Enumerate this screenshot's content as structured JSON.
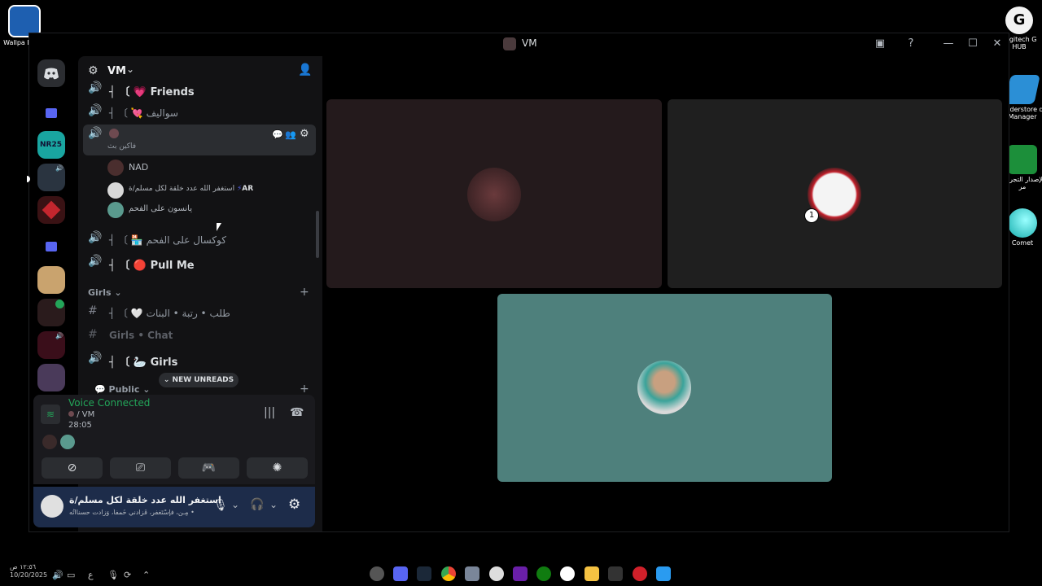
{
  "desktop": {
    "left_icons": [
      {
        "label": "Wallpaper Engine",
        "short": "Wallpa Engin"
      }
    ],
    "right_icons": [
      {
        "label": "Logitech G HUB",
        "short": "Logitech G HUB"
      },
      {
        "label": "Thunderstore Mod Manager",
        "short": "underst­ore d Manager"
      },
      {
        "label": "الإصدار التجريبي",
        "short": "الإصدار التجريبي مر"
      },
      {
        "label": "Comet",
        "short": "Comet"
      }
    ]
  },
  "window": {
    "title": "VM",
    "controls": {
      "inbox": "▣",
      "help": "?",
      "minimize": "—",
      "maximize": "☐",
      "close": "✕"
    }
  },
  "guild": {
    "name": "VM",
    "chevron": "⌄",
    "invite_icon": "add-member-icon"
  },
  "channels": {
    "items": [
      {
        "icon": "🔊",
        "prefix": "┤ 〔",
        "emoji": "💗",
        "label": "Friends",
        "style": "bold"
      },
      {
        "icon": "🔊",
        "prefix": "┤ 〔",
        "emoji": "💘",
        "label": "سواليف",
        "style": "normal"
      },
      {
        "icon": "🔊",
        "prefix": "",
        "emoji": "",
        "label": "",
        "subtitle": "فاكين بث",
        "style": "active"
      },
      {
        "icon": "🔊",
        "prefix": "┤ 〔",
        "emoji": "🏪",
        "label": "كوكسال على الفحم",
        "style": "normal"
      },
      {
        "icon": "🔊",
        "prefix": "┤ 〔",
        "emoji": "🔴",
        "label": "Pull Me",
        "style": "bold"
      }
    ],
    "voice_users": [
      {
        "name": "NAD"
      },
      {
        "name": "استغفر الله عدد خلقة لكل مسلم/ة",
        "badge": "AR"
      },
      {
        "name": "يانسون على الفحم"
      }
    ],
    "categories": [
      {
        "label": "Girls",
        "chevron": "⌄",
        "add": "+"
      },
      {
        "label": "Public",
        "chevron": "⌄",
        "add": "+"
      }
    ],
    "girls_channels": [
      {
        "icon": "#",
        "prefix": "┤ 〔",
        "emoji": "🤍",
        "label": "طلب • رتبة • البنات",
        "style": "normal"
      },
      {
        "icon": "#",
        "prefix": "",
        "emoji": "",
        "label": "Girls • Chat",
        "style": "faded"
      },
      {
        "icon": "🔊",
        "prefix": "┤ 〔",
        "emoji": "🦢",
        "label": "Girls",
        "style": "bold"
      }
    ],
    "new_unreads": "NEW UNREADS"
  },
  "voice_panel": {
    "status": "Voice Connected",
    "channel": "/ VM",
    "timer": "28:05",
    "status_color": "#23a559",
    "buttons": [
      "camera-off-icon",
      "screen-share-icon",
      "activity-icon",
      "soundboard-icon"
    ]
  },
  "user_panel": {
    "name": "استغفر الله عدد خلقة لكل مسلم/ة",
    "status": "مِـن، فإسْتَغفر، فَزادني خَمفاً، وَزادت حسنااتُه •"
  },
  "stage": {
    "tiles": [
      {
        "bg": "#241a1c"
      },
      {
        "bg": "#1f1f1f"
      },
      {
        "bg": "#4e807c"
      }
    ]
  },
  "taskbar": {
    "time": "١٢:٥٦ ص",
    "date": "10/20/2025",
    "lang": "ع"
  }
}
